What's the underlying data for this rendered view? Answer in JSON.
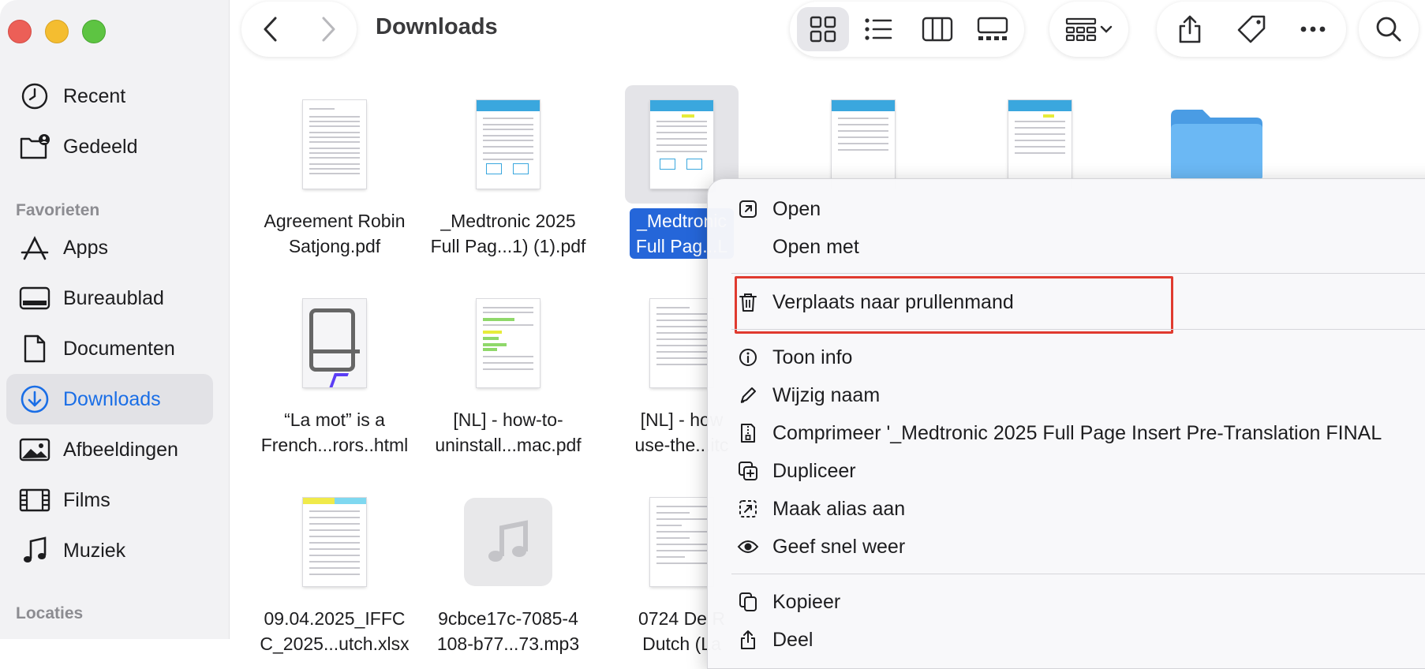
{
  "window": {
    "title": "Downloads"
  },
  "sidebar": {
    "items_top": [
      {
        "label": "Recent",
        "icon": "clock-icon"
      },
      {
        "label": "Gedeeld",
        "icon": "shared-folder-icon"
      }
    ],
    "favorites_header": "Favorieten",
    "favorites": [
      {
        "label": "Apps",
        "icon": "apps-icon"
      },
      {
        "label": "Bureaublad",
        "icon": "desktop-icon"
      },
      {
        "label": "Documenten",
        "icon": "document-icon"
      },
      {
        "label": "Downloads",
        "icon": "download-icon",
        "active": true
      },
      {
        "label": "Afbeeldingen",
        "icon": "photo-icon"
      },
      {
        "label": "Films",
        "icon": "film-icon"
      },
      {
        "label": "Muziek",
        "icon": "music-icon"
      }
    ],
    "locations_header": "Locaties"
  },
  "files": [
    {
      "line1": "Agreement Robin",
      "line2": "Satjong.pdf",
      "kind": "pdf"
    },
    {
      "line1": "_Medtronic 2025",
      "line2": "Full Pag...1) (1).pdf",
      "kind": "medtronic"
    },
    {
      "line1": "_Medtronic",
      "line2": "Full Pag...L",
      "kind": "medtronic",
      "selected": true
    },
    {
      "line1": "",
      "line2": "",
      "kind": "medtronic"
    },
    {
      "line1": "",
      "line2": "",
      "kind": "medtronic"
    },
    {
      "line1": "",
      "line2": "",
      "kind": "folder"
    },
    {
      "line1": "“La mot” is a",
      "line2": "French...rors..html",
      "kind": "html"
    },
    {
      "line1": "[NL] - how-to-",
      "line2": "uninstall...mac.pdf",
      "kind": "pdf-color"
    },
    {
      "line1": "[NL] - how",
      "line2": "use-the...itc",
      "kind": "pdf"
    },
    {
      "line1": "09.04.2025_IFFC",
      "line2": "C_2025...utch.xlsx",
      "kind": "xlsx"
    },
    {
      "line1": "9cbce17c-7085-4",
      "line2": "108-b77...73.mp3",
      "kind": "mp3"
    },
    {
      "line1": "0724 De R",
      "line2": "Dutch (La",
      "kind": "pdf"
    }
  ],
  "context_menu": {
    "items": [
      {
        "label": "Open",
        "icon": "open-icon"
      },
      {
        "label": "Open met",
        "icon": ""
      },
      {
        "label": "Verplaats naar prullenmand",
        "icon": "trash-icon",
        "highlighted": true
      },
      {
        "label": "Toon info",
        "icon": "info-icon"
      },
      {
        "label": "Wijzig naam",
        "icon": "pencil-icon"
      },
      {
        "label": "Comprimeer '_Medtronic 2025 Full Page Insert Pre-Translation FINAL",
        "icon": "archive-icon"
      },
      {
        "label": "Dupliceer",
        "icon": "duplicate-icon"
      },
      {
        "label": "Maak alias aan",
        "icon": "alias-icon"
      },
      {
        "label": "Geef snel weer",
        "icon": "eye-icon"
      },
      {
        "label": "Kopieer",
        "icon": "copy-icon"
      },
      {
        "label": "Deel",
        "icon": "share-icon"
      }
    ]
  },
  "colors": {
    "accent": "#1a6ee6",
    "selection": "#2566d9",
    "highlight_box": "#e03a2f",
    "folder": "#5aaef0"
  }
}
